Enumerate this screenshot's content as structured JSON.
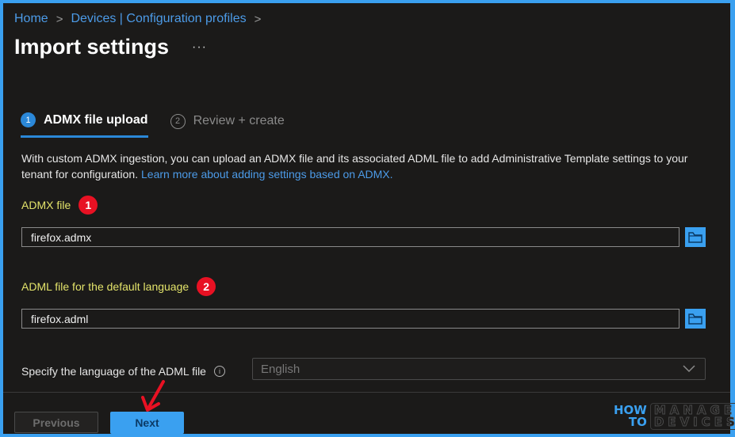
{
  "breadcrumb": {
    "items": [
      "Home",
      "Devices | Configuration profiles"
    ],
    "separator": ">"
  },
  "header": {
    "title": "Import settings",
    "more_label": "···"
  },
  "wizard": {
    "steps": [
      {
        "number": "1",
        "label": "ADMX file upload",
        "active": true
      },
      {
        "number": "2",
        "label": "Review + create",
        "active": false
      }
    ]
  },
  "description": {
    "text": "With custom ADMX ingestion, you can upload an ADMX file and its associated ADML file to add Administrative Template settings to your tenant for configuration. ",
    "link": "Learn more about adding settings based on ADMX."
  },
  "fields": {
    "admx": {
      "label": "ADMX file",
      "value": "firefox.admx",
      "annotation": "1"
    },
    "adml": {
      "label": "ADML file for the default language",
      "value": "firefox.adml",
      "annotation": "2"
    },
    "language": {
      "label": "Specify the language of the ADML file",
      "info_icon": "info-icon",
      "selected": "English"
    }
  },
  "footer": {
    "previous_label": "Previous",
    "next_label": "Next"
  },
  "watermark": {
    "line1": "HOW",
    "line2": "TO",
    "box_line1": "MANAGE",
    "box_line2": "DEVICES"
  },
  "colors": {
    "accent": "#3aa0f0",
    "link": "#4c9be8",
    "label_highlight": "#e3e36a",
    "annotation": "#e81123",
    "background": "#1b1a19"
  }
}
